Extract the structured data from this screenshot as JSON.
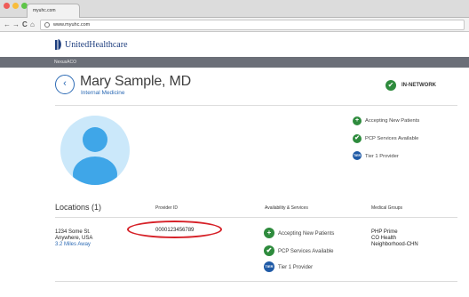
{
  "browser": {
    "tab_title": "myuhc.com",
    "url": "www.myuhc.com",
    "back_glyph": "←",
    "forward_glyph": "→",
    "reload_glyph": "C",
    "home_glyph": "⌂"
  },
  "brand": {
    "logo_text": "UnitedHealthcare",
    "network_label": "NexusACO"
  },
  "provider": {
    "name": "Mary Sample, MD",
    "specialty": "Internal Medicine",
    "network_status": "IN-NETWORK",
    "features": [
      {
        "icon": "plus-icon",
        "label": "Accepting New Patients"
      },
      {
        "icon": "check-icon",
        "label": "PCP Services Available"
      },
      {
        "icon": "tier-1-icon",
        "label": "Tier 1 Provider"
      }
    ]
  },
  "locations": {
    "title": "Locations (1)",
    "columns": [
      "Provider ID",
      "Availability & Services",
      "Medical Groups"
    ],
    "row": {
      "address_line1": "1234 Some St.",
      "address_line2": "Anywhere, USA",
      "distance": "3.2 Miles Away",
      "provider_id": "0000123456789",
      "availability": [
        "Accepting New Patients",
        "PCP Services Available",
        "Tier 1 Provider"
      ],
      "medical_group": [
        "PHP Prime",
        "CO Health",
        "Neighborhood-CHN"
      ]
    }
  },
  "icons": {
    "plus": "+",
    "check": "✔",
    "tier": "TIER 1"
  },
  "colors": {
    "accent_blue": "#2d6bb5",
    "status_green": "#2e8b3d",
    "tier_blue": "#1f5aa6",
    "highlight_red": "#d62128"
  }
}
